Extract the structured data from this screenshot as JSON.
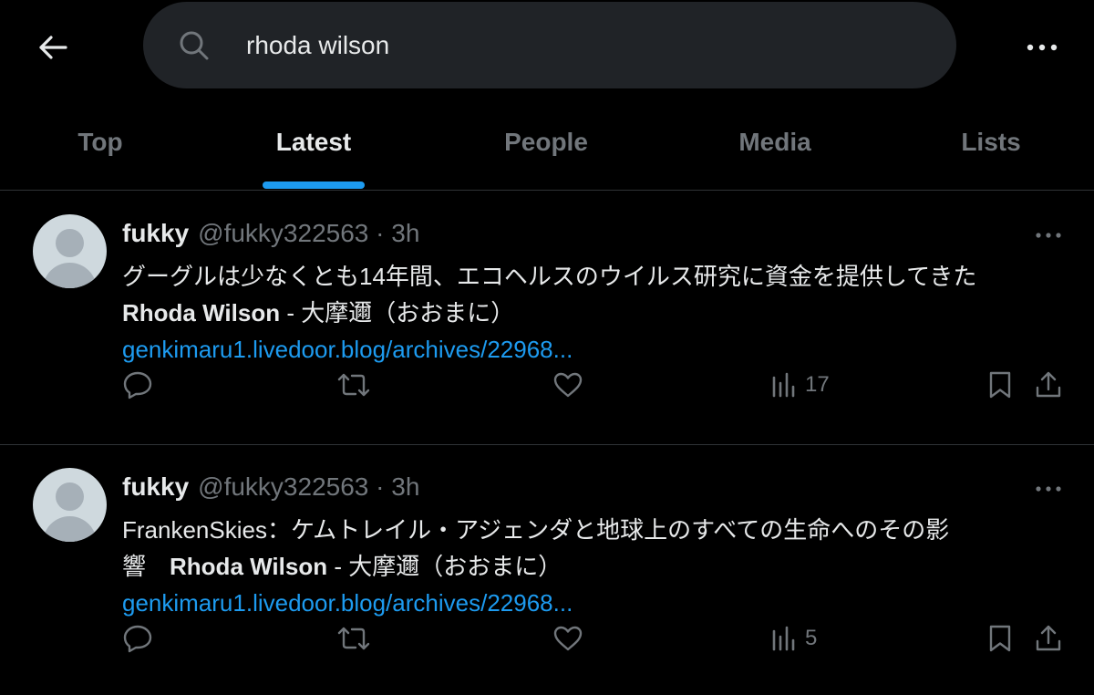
{
  "search": {
    "query": "rhoda wilson"
  },
  "tabs": [
    {
      "label": "Top"
    },
    {
      "label": "Latest"
    },
    {
      "label": "People"
    },
    {
      "label": "Media"
    },
    {
      "label": "Lists"
    }
  ],
  "active_tab": "Latest",
  "colors": {
    "accent": "#1d9bf0",
    "background": "#000000",
    "search_bg": "#202327",
    "muted": "#71767b",
    "text": "#e7e9ea"
  },
  "tweets": [
    {
      "display_name": "fukky",
      "handle": "@fukky322563",
      "separator": " · ",
      "time": "3h",
      "text_line1": "グーグルは少なくとも14年間、エコヘルスのウイルス研究に資金を提供してきた",
      "text_line2_bold": "Rhoda Wilson",
      "text_line2_rest": " - 大摩邇（おおまに）",
      "link": "genkimaru1.livedoor.blog/archives/22968...",
      "views": "17"
    },
    {
      "display_name": "fukky",
      "handle": "@fukky322563",
      "separator": " · ",
      "time": "3h",
      "text_line1": "FrankenSkies：ケムトレイル・アジェンダと地球上のすべての生命へのその影",
      "text_line2_prefix": "響　",
      "text_line2_bold": "Rhoda Wilson",
      "text_line2_rest": " - 大摩邇（おおまに）",
      "link": "genkimaru1.livedoor.blog/archives/22968...",
      "views": "5"
    }
  ]
}
